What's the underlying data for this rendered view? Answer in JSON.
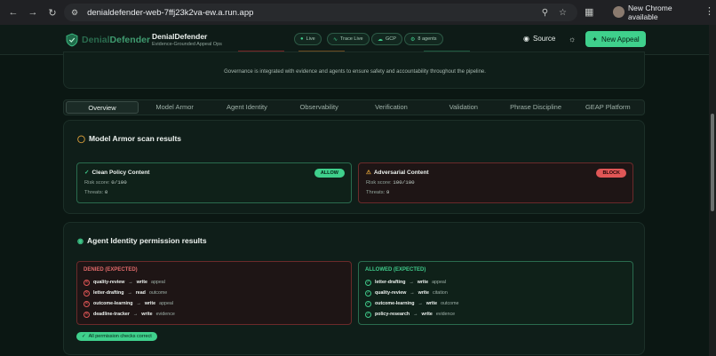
{
  "browser": {
    "url": "denialdefender-web-7ffj23k2va-ew.a.run.app",
    "update_label": "New Chrome available"
  },
  "header": {
    "brand_left": "Denial",
    "brand_right": "Defender",
    "app_title": "DenialDefender",
    "app_subtitle": "Evidence-Grounded Appeal Ops",
    "pills": [
      "Live",
      "Trace Live",
      "GCP",
      "8 agents"
    ],
    "source_label": "Source",
    "new_appeal_label": "New Appeal"
  },
  "governance": {
    "text": "Governance is integrated with evidence and agents to ensure safety and accountability throughout the pipeline."
  },
  "tabs": [
    "Overview",
    "Model Armor",
    "Agent Identity",
    "Observability",
    "Verification",
    "Validation",
    "Phrase Discipline",
    "GEAP Platform"
  ],
  "model_armor": {
    "title": "Model Armor scan results",
    "scans": [
      {
        "name": "Clean Policy Content",
        "badge": "ALLOW",
        "risk_label": "Risk score:",
        "risk": "0/100",
        "threats_label": "Threats:",
        "threats": "0"
      },
      {
        "name": "Adversarial Content",
        "badge": "BLOCK",
        "risk_label": "Risk score:",
        "risk": "100/100",
        "threats_label": "Threats:",
        "threats": "9"
      }
    ]
  },
  "agent_identity": {
    "title": "Agent Identity permission results",
    "denied_header": "DENIED (EXPECTED)",
    "denied": [
      {
        "agent": "quality-review",
        "arrow": "→",
        "verb": "write",
        "target": "appeal"
      },
      {
        "agent": "letter-drafting",
        "arrow": "→",
        "verb": "read",
        "target": "outcome"
      },
      {
        "agent": "outcome-learning",
        "arrow": "→",
        "verb": "write",
        "target": "appeal"
      },
      {
        "agent": "deadline-tracker",
        "arrow": "→",
        "verb": "write",
        "target": "evidence"
      }
    ],
    "allowed_header": "ALLOWED (EXPECTED)",
    "allowed": [
      {
        "agent": "letter-drafting",
        "arrow": "→",
        "verb": "write",
        "target": "appeal"
      },
      {
        "agent": "quality-review",
        "arrow": "→",
        "verb": "write",
        "target": "citation"
      },
      {
        "agent": "outcome-learning",
        "arrow": "→",
        "verb": "write",
        "target": "outcome"
      },
      {
        "agent": "policy-research",
        "arrow": "→",
        "verb": "write",
        "target": "evidence"
      }
    ],
    "summary": "All permission checks correct"
  },
  "colors": {
    "accent": "#3fd08c",
    "danger": "#e05656",
    "warning": "#e0a23a"
  }
}
